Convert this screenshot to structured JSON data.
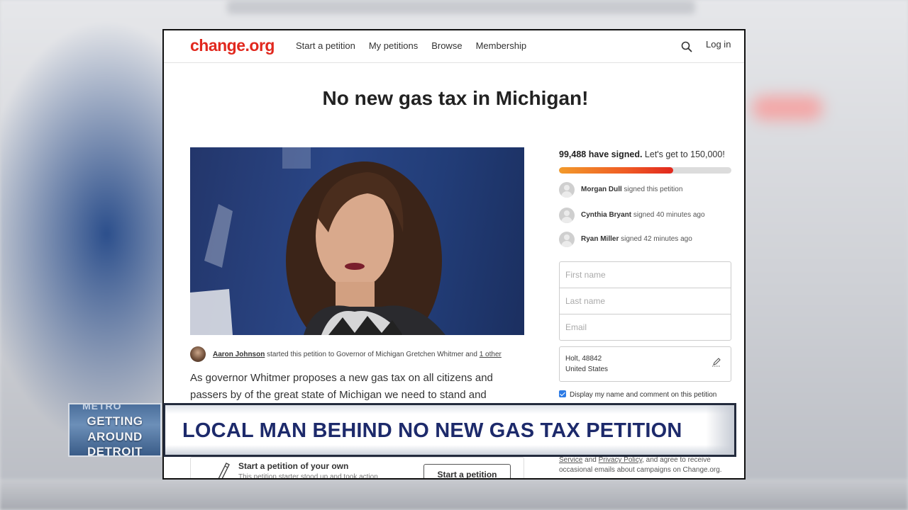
{
  "nav": {
    "logo": "change.org",
    "links": [
      "Start a petition",
      "My petitions",
      "Browse",
      "Membership"
    ],
    "login": "Log in"
  },
  "petition": {
    "title": "No new gas tax in Michigan!",
    "starter_name": "Aaron Johnson",
    "starter_text": " started this petition to Governor of Michigan Gretchen Whitmer and ",
    "starter_other": "1 other",
    "body": "As governor Whitmer proposes a new gas tax on all citizens and passers by of the great state of Michigan we need to stand and"
  },
  "start_card": {
    "heading": "Start a petition of your own",
    "sub": "This petition starter stood up and took action.",
    "button": "Start a petition"
  },
  "sidebar": {
    "signed_count": "99,488 have signed.",
    "goal_text": " Let's get to 150,000!",
    "progress_fraction": 0.663,
    "signers": [
      {
        "name": "Morgan Dull",
        "action": " signed this petition"
      },
      {
        "name": "Cynthia Bryant",
        "action": " signed 40 minutes ago"
      },
      {
        "name": "Ryan Miller",
        "action": " signed 42 minutes ago"
      }
    ],
    "form": {
      "first_name_placeholder": "First name",
      "last_name_placeholder": "Last name",
      "email_placeholder": "Email"
    },
    "location_line1": "Holt, 48842",
    "location_line2": "United States",
    "display_label": "Display my name and comment on this petition",
    "terms_link1": "Service",
    "terms_and": " and ",
    "terms_link2": "Privacy Policy",
    "terms_rest": ", and agree to receive occasional emails about campaigns on Change.org."
  },
  "banner": {
    "logo_top": "METRO",
    "logo_line1": "GETTING",
    "logo_line2": "AROUND",
    "logo_line3": "DETROIT",
    "headline": "LOCAL MAN BEHIND NO NEW GAS TAX PETITION"
  },
  "colors": {
    "brand_red": "#e1281e",
    "banner_navy": "#1d2a6b",
    "checkbox_blue": "#2d7be5"
  }
}
